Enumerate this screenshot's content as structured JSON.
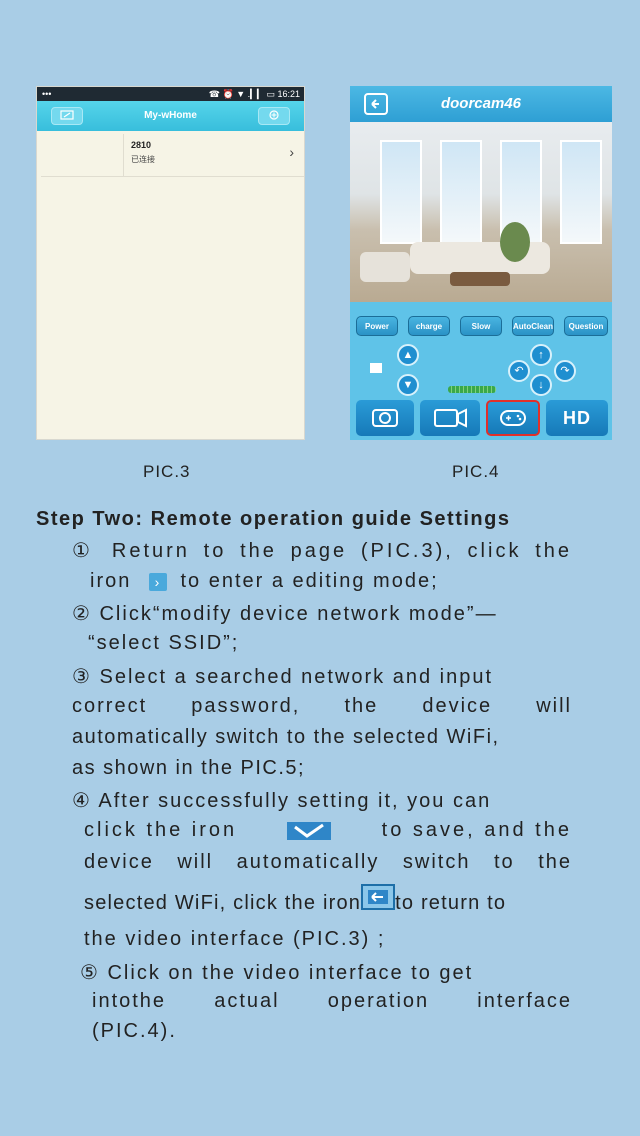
{
  "pic3": {
    "statusbar_left": "•••",
    "statusbar_right": "☎ ⏰ ▼ .▎▎ ▭ 16:21",
    "title": "My-wHome",
    "device_name": "2810",
    "device_status": "已连接"
  },
  "pic4": {
    "title": "doorcam46",
    "tools": [
      "Power",
      "charge",
      "Slow",
      "AutoClean",
      "Question"
    ],
    "hd_label": "HD"
  },
  "captions": {
    "left": "PIC.3",
    "right": "PIC.4"
  },
  "step": {
    "heading": "Step Two: Remote operation guide Settings",
    "s1_line1": "① Return to the page (PIC.3), click the",
    "s1_line2a": "iron",
    "s1_line2b": "to enter a editing mode;",
    "s2_line1": "② Click“modify device network mode”—",
    "s2_line2": "“select SSID”;",
    "s3_line1": "③ Select a searched network and input",
    "s3_line2": "correct password, the device will",
    "s3_line3": "automatically switch to the selected WiFi,",
    "s3_line4": "as shown in the PIC.5;",
    "s4_line1": "④ After successfully setting it, you can",
    "s4_line2a": "click the iron",
    "s4_line2b": "to save, and the",
    "s4_line3": "device will automatically switch to the",
    "s4_line4a": "selected WiFi, click the iron",
    "s4_line4b": "to return to",
    "s4_line5": "the video interface (PIC.3) ;",
    "s5_line1": "⑤ Click on the video   interface to get",
    "s5_line2": "intothe actual operation interface",
    "s5_line3": "(PIC.4)."
  },
  "colors": {
    "background": "#a9cde6",
    "accent": "#2e9fd4"
  }
}
